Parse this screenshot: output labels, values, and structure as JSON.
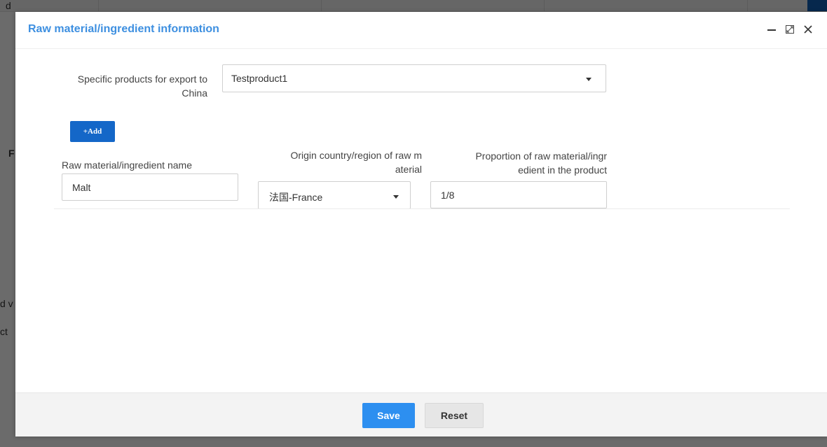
{
  "background_page": {
    "fragments": [
      "d",
      "F",
      "d v",
      "ct"
    ]
  },
  "dialog": {
    "title": "Raw material/ingredient information",
    "window_controls": [
      "minimize-icon",
      "maximize-icon",
      "close-icon"
    ]
  },
  "product_field": {
    "label_line1": "Specific products for export to",
    "label_line2": "China",
    "value": "Testproduct1"
  },
  "add_button": {
    "icon": "+",
    "label": "Add"
  },
  "ingredient_row": {
    "name_label": "Raw material/ingredient name",
    "name_value": "Malt",
    "origin_label_line1": "Origin country/region of raw m",
    "origin_label_line2": "aterial",
    "origin_value": "法国-France",
    "proportion_label_line1": "Proportion of raw material/ingr",
    "proportion_label_line2": "edient in the product",
    "proportion_value": "1/8"
  },
  "footer": {
    "save_label": "Save",
    "reset_label": "Reset"
  },
  "colors": {
    "title": "#3d8fe0",
    "add_button": "#1467c8",
    "save_button": "#2d8ff0",
    "overlay": "#6b6b6b"
  }
}
